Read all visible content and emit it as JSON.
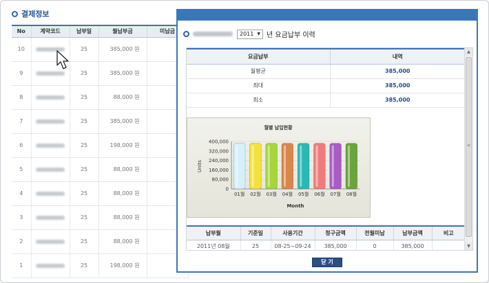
{
  "page": {
    "section_title": "결제정보",
    "table": {
      "headers": [
        "No",
        "계약코드",
        "납부일",
        "월납부금",
        "미납금"
      ],
      "rows": [
        {
          "no": "10",
          "day": "25",
          "amount": "385,000 원"
        },
        {
          "no": "9",
          "day": "25",
          "amount": "385,000 원"
        },
        {
          "no": "8",
          "day": "25",
          "amount": "88,000 원"
        },
        {
          "no": "7",
          "day": "25",
          "amount": "385,000 원"
        },
        {
          "no": "6",
          "day": "25",
          "amount": "198,000 원"
        },
        {
          "no": "5",
          "day": "25",
          "amount": "88,000 원"
        },
        {
          "no": "4",
          "day": "25",
          "amount": "88,000 원"
        },
        {
          "no": "3",
          "day": "25",
          "amount": "88,000 원"
        },
        {
          "no": "2",
          "day": "25",
          "amount": "88,000 원"
        },
        {
          "no": "1",
          "day": "25",
          "amount": "198,000 원"
        }
      ]
    }
  },
  "popup": {
    "year_value": "2011",
    "title_suffix": "년 요금납부 이력",
    "summary": {
      "headers": [
        "요금납부",
        "내역"
      ],
      "rows": [
        {
          "label": "월평균",
          "value": "385,000"
        },
        {
          "label": "최대",
          "value": "385,000"
        },
        {
          "label": "최소",
          "value": "385,000"
        }
      ]
    },
    "history": {
      "headers": [
        "납부월",
        "기준일",
        "사용기간",
        "청구금액",
        "전월미납",
        "납부금액",
        "비고"
      ],
      "rows": [
        [
          "2011년 08월",
          "25",
          "08-25~09-24",
          "385,000",
          "0",
          "385,000",
          ""
        ]
      ]
    },
    "close_label": "닫 기"
  },
  "chart_data": {
    "type": "bar",
    "title": "월별 납입현황",
    "xlabel": "Month",
    "ylabel": "Units",
    "ylim": [
      0,
      400000
    ],
    "y_ticks": [
      "0",
      "80,000",
      "160,000",
      "240,000",
      "320,000",
      "400,000"
    ],
    "categories": [
      "01월",
      "02월",
      "03월",
      "04월",
      "05월",
      "06월",
      "07월",
      "08월"
    ],
    "values": [
      385000,
      385000,
      385000,
      385000,
      385000,
      385000,
      385000,
      385000
    ],
    "colors": [
      "#d6f0fa",
      "#f4e23c",
      "#a6d63a",
      "#d8874a",
      "#2ab8b4",
      "#f07b7b",
      "#a85cc4",
      "#6aa43a"
    ]
  }
}
